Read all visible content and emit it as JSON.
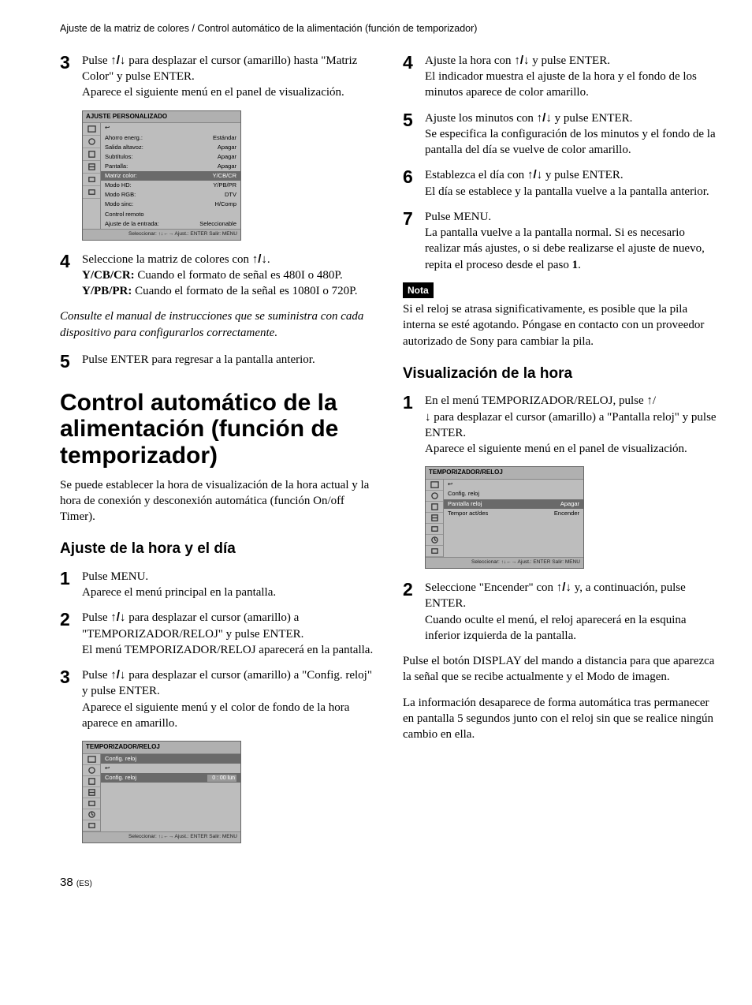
{
  "header": "Ajuste de la matriz de colores / Control automático de la alimentación (función de temporizador)",
  "arrows": "↑/↓",
  "left": {
    "step3a": "Pulse ",
    "step3b": " para desplazar el cursor (amarillo) hasta \"Matriz Color\" y pulse ENTER.",
    "step3c": "Aparece el siguiente menú en el panel de visualización.",
    "menu1": {
      "title": "AJUSTE PERSONALIZADO",
      "back": "↩",
      "rows": [
        {
          "l": "Ahorro energ.:",
          "v": "Estándar"
        },
        {
          "l": "Salida altavoz:",
          "v": "Apagar"
        },
        {
          "l": "Subtítulos:",
          "v": "Apagar"
        },
        {
          "l": "Pantalla:",
          "v": "Apagar"
        },
        {
          "l": "Matriz color:",
          "v": "Y/CB/CR",
          "hi": true
        },
        {
          "l": "Modo HD:",
          "v": "Y/PB/PR"
        },
        {
          "l": "Modo RGB:",
          "v": "DTV"
        },
        {
          "l": "Modo sinc:",
          "v": "H/Comp"
        },
        {
          "l": "Control remoto",
          "v": ""
        },
        {
          "l": "Ajuste de la entrada:",
          "v": "Seleccionable"
        }
      ],
      "footer": "Seleccionar: ↑↓←→   Ajust.: ENTER   Salir: MENU"
    },
    "step4a": "Seleccione la matriz de colores con ",
    "step4b": ".",
    "step4c_lbl": "Y/CB/CR:",
    "step4c": " Cuando el formato de señal es 480I o 480P.",
    "step4d_lbl": "Y/PB/PR:",
    "step4d": " Cuando el formato de la señal es 1080I o 720P.",
    "italic": "Consulte el manual de instrucciones que se suministra con cada dispositivo para configurarlos correctamente.",
    "step5": "Pulse ENTER para regresar a la pantalla anterior.",
    "h1": "Control automático de la alimentación (función de temporizador)",
    "intro": "Se puede establecer la hora de visualización de la hora actual y la hora de conexión y desconexión automática (función On/off Timer).",
    "h2": "Ajuste de la hora y el día",
    "s1a": "Pulse MENU.",
    "s1b": "Aparece el menú principal en la pantalla.",
    "s2a": "Pulse ",
    "s2b": " para desplazar el cursor (amarillo) a \"TEMPORIZADOR/RELOJ\" y pulse ENTER.",
    "s2c": "El menú TEMPORIZADOR/RELOJ aparecerá en la pantalla.",
    "s3a": "Pulse ",
    "s3b": " para desplazar el cursor (amarillo) a \"Config. reloj\" y pulse ENTER.",
    "s3c": "Aparece el siguiente menú y el color de fondo de la hora aparece en amarillo.",
    "menu2": {
      "title": "TEMPORIZADOR/RELOJ",
      "crumb": "Config. reloj",
      "back": "↩",
      "row": {
        "l": "Config. reloj",
        "v": "0 : 00  lun",
        "hi": true
      },
      "footer": "Seleccionar: ↑↓←→   Ajust.: ENTER   Salir: MENU"
    }
  },
  "right": {
    "s4a": "Ajuste la hora con ",
    "s4b": " y pulse ENTER.",
    "s4c": "El indicador muestra el ajuste de la hora y el fondo de los minutos aparece de color amarillo.",
    "s5a": "Ajuste los minutos con ",
    "s5b": " y pulse ENTER.",
    "s5c": "Se especifica la configuración de los minutos y el fondo de la pantalla del día se vuelve de color amarillo.",
    "s6a": "Establezca el día con ",
    "s6b": " y pulse ENTER.",
    "s6c": "El día se establece y la pantalla vuelve a la pantalla anterior.",
    "s7a": "Pulse MENU.",
    "s7b": "La pantalla vuelve a la pantalla normal. Si es necesario realizar más ajustes, o si debe realizarse el ajuste de nuevo, repita el proceso desde el paso ",
    "s7c": "1",
    "s7d": ".",
    "nota_lbl": "Nota",
    "nota": "Si el reloj se atrasa significativamente, es posible que la pila interna se esté agotando. Póngase en contacto con un proveedor autorizado de Sony para cambiar la pila.",
    "h2": "Visualización de la hora",
    "v1a": "En el menú TEMPORIZADOR/RELOJ, pulse ",
    "v1b": " para desplazar el cursor (amarillo) a \"Pantalla reloj\" y pulse ENTER.",
    "v1c": "Aparece el siguiente menú en el panel de visualización.",
    "menu3": {
      "title": "TEMPORIZADOR/RELOJ",
      "back": "↩",
      "rows": [
        {
          "l": "Config. reloj",
          "v": ""
        },
        {
          "l": "Pantalla reloj",
          "v": "Apagar",
          "hi": true
        },
        {
          "l": "Tempor act/des",
          "v": "Encender"
        }
      ],
      "footer": "Seleccionar: ↑↓←→   Ajust.: ENTER   Salir: MENU"
    },
    "v2a": "Seleccione \"Encender\" con ",
    "v2b": " y, a continuación, pulse ENTER.",
    "v2c": "Cuando oculte el menú, el reloj aparecerá en la esquina inferior izquierda de la pantalla.",
    "tail1": "Pulse el botón DISPLAY del mando a distancia para que aparezca la señal que se recibe actualmente y el Modo de imagen.",
    "tail2": "La información desaparece de forma automática tras permanecer en pantalla 5 segundos junto con el reloj sin que se realice ningún cambio en ella."
  },
  "page": "38",
  "page_suffix": "(ES)"
}
